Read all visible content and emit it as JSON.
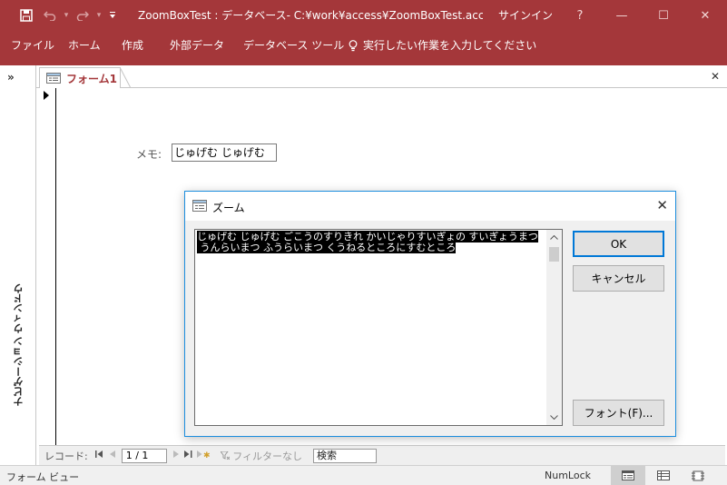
{
  "titlebar": {
    "title": "ZoomBoxTest : データベース- C:¥work¥access¥ZoomBoxTest.acc…",
    "signin": "サインイン",
    "help": "?",
    "minimize": "—",
    "maximize": "☐",
    "close": "✕",
    "bg_color": "#a4373a"
  },
  "ribbon": {
    "tabs": [
      "ファイル",
      "ホーム",
      "作成",
      "外部データ",
      "データベース ツール"
    ],
    "tell_me": "実行したい作業を入力してください"
  },
  "navpane": {
    "chevron": "»",
    "label": "ナビゲーション ウィンドウ"
  },
  "document": {
    "tab_label": "フォーム1",
    "close": "✕",
    "memo_label": "メモ:",
    "memo_value": "じゅげむ じゅげむ"
  },
  "recnav": {
    "label": "レコード:",
    "first": "⏮",
    "prev": "◀",
    "position": "1 / 1",
    "next": "▶",
    "last": "⏭",
    "new": "▶✱",
    "filter": "フィルターなし",
    "search": "検索"
  },
  "statusbar": {
    "left": "フォーム ビュー",
    "numlock": "NumLock"
  },
  "zoom_dialog": {
    "title": "ズーム",
    "close": "✕",
    "text_lines": [
      "じゅげむ じゅげむ ごこうのすりきれ かいじゃりすいぎょの すいぎょうまつ",
      " うんらいまつ ふうらいまつ くうねるところにすむところ"
    ],
    "ok": "OK",
    "cancel": "キャンセル",
    "font": "フォント(F)..."
  }
}
